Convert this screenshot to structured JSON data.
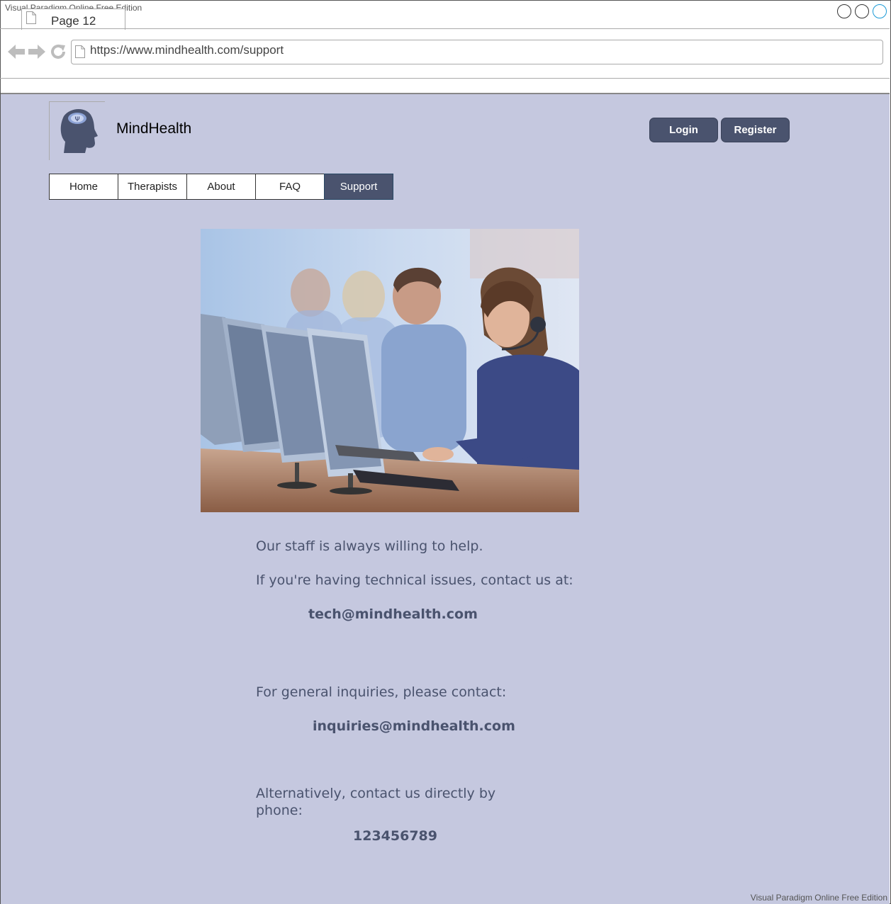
{
  "app": {
    "watermark": "Visual Paradigm Online Free Edition"
  },
  "browser": {
    "tab_label": "Page 12",
    "url": "https://www.mindhealth.com/support"
  },
  "site": {
    "brand": "MindHealth",
    "login_label": "Login",
    "register_label": "Register",
    "menu": [
      {
        "label": "Home"
      },
      {
        "label": "Therapists"
      },
      {
        "label": "About"
      },
      {
        "label": "FAQ"
      },
      {
        "label": "Support",
        "active": true
      }
    ]
  },
  "content": {
    "intro": "Our staff is always willing to help.",
    "tech_text": "If you're having technical issues, contact us at:",
    "tech_email": "tech@mindhealth.com",
    "general_text": "For general inquiries, please contact:",
    "general_email": "inquiries@mindhealth.com",
    "phone_text": "Alternatively, contact us directly by phone:",
    "phone": "123456789"
  },
  "colors": {
    "page_bg": "#c5c8df",
    "accent": "#4a536e"
  }
}
